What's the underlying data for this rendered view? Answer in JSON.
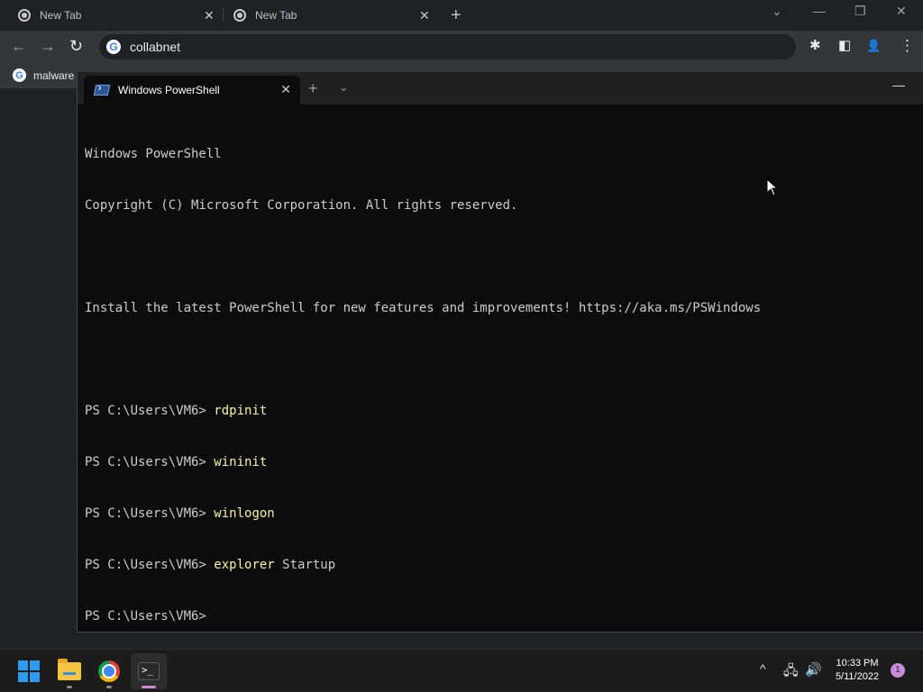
{
  "browser": {
    "tabs": [
      {
        "label": "New Tab",
        "close_glyph": "✕",
        "icon": "chrome-favicon"
      },
      {
        "label": "New Tab",
        "close_glyph": "✕",
        "icon": "chrome-favicon"
      }
    ],
    "new_tab_glyph": "+",
    "window_controls": {
      "tab_search": "⌄",
      "minimize": "—",
      "restore": "❐",
      "close": "✕"
    },
    "toolbar": {
      "back_glyph": "←",
      "forward_glyph": "→",
      "reload_glyph": "↻",
      "address": "collabnet",
      "extensions_glyph": "✱",
      "sidepanel_glyph": "◧",
      "profile_glyph": "👤",
      "menu_glyph": "⋮"
    },
    "bookmarks": [
      {
        "label": "malware",
        "icon": "google-g-icon"
      }
    ]
  },
  "terminal": {
    "tab_label": "Windows PowerShell",
    "tab_close_glyph": "✕",
    "new_tab_glyph": "+",
    "dropdown_glyph": "⌄",
    "minimize_glyph": "—",
    "lines": [
      {
        "prompt": "Windows PowerShell",
        "cmd": "",
        "arg": ""
      },
      {
        "prompt": "Copyright (C) Microsoft Corporation. All rights reserved.",
        "cmd": "",
        "arg": ""
      },
      {
        "prompt": "",
        "cmd": "",
        "arg": ""
      },
      {
        "prompt": "Install the latest PowerShell for new features and improvements! https://aka.ms/PSWindows",
        "cmd": "",
        "arg": ""
      },
      {
        "prompt": "",
        "cmd": "",
        "arg": ""
      },
      {
        "prompt": "PS C:\\Users\\VM6> ",
        "cmd": "rdpinit",
        "arg": ""
      },
      {
        "prompt": "PS C:\\Users\\VM6> ",
        "cmd": "wininit",
        "arg": ""
      },
      {
        "prompt": "PS C:\\Users\\VM6> ",
        "cmd": "winlogon",
        "arg": ""
      },
      {
        "prompt": "PS C:\\Users\\VM6> ",
        "cmd": "explorer",
        "arg": " Startup"
      },
      {
        "prompt": "PS C:\\Users\\VM6>",
        "cmd": "",
        "arg": ""
      }
    ]
  },
  "taskbar": {
    "apps": [
      {
        "name": "start",
        "active": false
      },
      {
        "name": "file-explorer",
        "active": false
      },
      {
        "name": "chrome",
        "active": false
      },
      {
        "name": "windows-terminal",
        "active": true
      }
    ],
    "tray": {
      "chevron_glyph": "^",
      "network_glyph": "🖧",
      "volume_glyph": "🔊"
    },
    "time": "10:33 PM",
    "date": "5/11/2022",
    "notification_count": "1"
  },
  "colors": {
    "command_text": "#f9f1a5",
    "terminal_bg": "#0c0c0c",
    "accent": "#c98bd9"
  }
}
